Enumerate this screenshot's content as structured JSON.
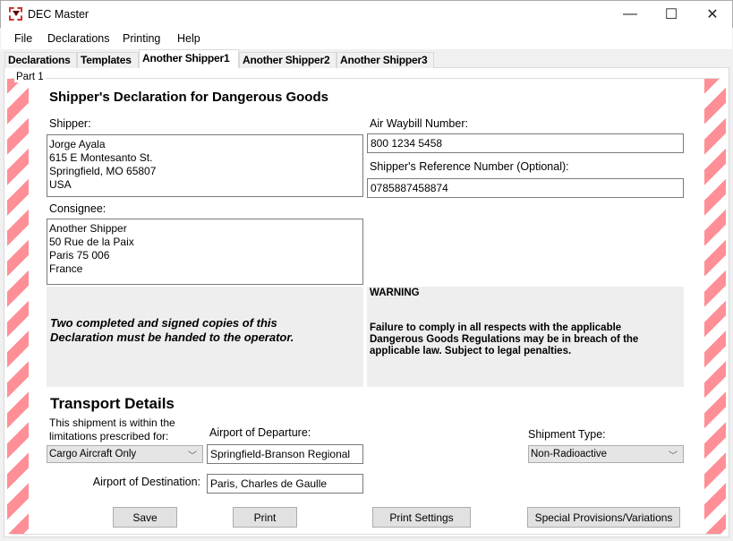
{
  "window": {
    "title": "DEC Master",
    "minimize": "—",
    "maximize": "☐",
    "close": "✕"
  },
  "menu": [
    "File",
    "Declarations",
    "Printing",
    "Help"
  ],
  "tabs": [
    {
      "label": "Declarations"
    },
    {
      "label": "Templates"
    },
    {
      "label": "Another Shipper1",
      "active": true
    },
    {
      "label": "Another Shipper2"
    },
    {
      "label": "Another Shipper3"
    }
  ],
  "group_label": "Part 1",
  "heading": "Shipper's Declaration for Dangerous Goods",
  "shipper": {
    "label": "Shipper:",
    "value": "Jorge Ayala\n615 E Montesanto St.\nSpringfield, MO 65807\nUSA"
  },
  "consignee": {
    "label": "Consignee:",
    "value": "Another Shipper\n50 Rue de la Paix\nParis 75 006\nFrance"
  },
  "awb": {
    "label": "Air Waybill Number:",
    "value": "800 1234 5458"
  },
  "ref": {
    "label": "Shipper's Reference Number (Optional):",
    "value": "0785887458874"
  },
  "notice": "Two completed and signed copies of this Declaration must be handed to the operator.",
  "warning": {
    "title": "WARNING",
    "text": "Failure to comply in all respects with the applicable Dangerous Goods Regulations may be in breach of the applicable law.  Subject to legal penalties."
  },
  "transport": {
    "heading": "Transport Details",
    "limitations_label": "This shipment is within the limitations prescribed for:",
    "limitations_value": "Cargo Aircraft Only",
    "departure_label": "Airport of Departure:",
    "departure_value": "Springfield-Branson Regional",
    "destination_label": "Airport of Destination:",
    "destination_value": "Paris, Charles de Gaulle",
    "shipment_type_label": "Shipment Type:",
    "shipment_type_value": "Non-Radioactive"
  },
  "buttons": {
    "save": "Save",
    "print": "Print",
    "print_settings": "Print Settings",
    "special": "Special Provisions/Variations"
  },
  "colors": {
    "stripe": "#ff8f96",
    "panel_gray": "#eeeeee"
  }
}
